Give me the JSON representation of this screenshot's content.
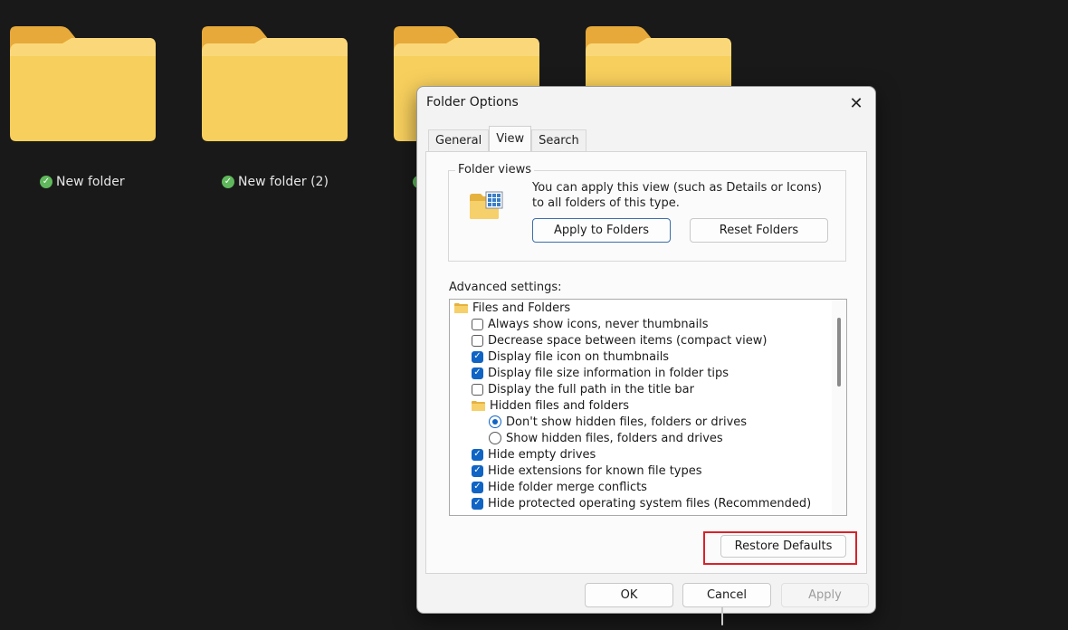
{
  "desktop": {
    "folders": [
      {
        "name": "New folder"
      },
      {
        "name": "New folder (2)"
      },
      {
        "name": ""
      },
      {
        "name": ""
      }
    ]
  },
  "dialog": {
    "title": "Folder Options",
    "close_icon": "close-icon",
    "tabs": [
      {
        "label": "General",
        "active": false
      },
      {
        "label": "View",
        "active": true
      },
      {
        "label": "Search",
        "active": false
      }
    ],
    "folder_views": {
      "legend": "Folder views",
      "description": "You can apply this view (such as Details or Icons) to all folders of this type.",
      "apply_label": "Apply to Folders",
      "reset_label": "Reset Folders"
    },
    "advanced": {
      "label": "Advanced settings:",
      "items": [
        {
          "type": "folder",
          "level": 0,
          "label": "Files and Folders"
        },
        {
          "type": "checkbox",
          "level": 1,
          "checked": false,
          "label": "Always show icons, never thumbnails"
        },
        {
          "type": "checkbox",
          "level": 1,
          "checked": false,
          "label": "Decrease space between items (compact view)"
        },
        {
          "type": "checkbox",
          "level": 1,
          "checked": true,
          "label": "Display file icon on thumbnails"
        },
        {
          "type": "checkbox",
          "level": 1,
          "checked": true,
          "label": "Display file size information in folder tips"
        },
        {
          "type": "checkbox",
          "level": 1,
          "checked": false,
          "label": "Display the full path in the title bar"
        },
        {
          "type": "folder",
          "level": 1,
          "label": "Hidden files and folders"
        },
        {
          "type": "radio",
          "level": 2,
          "checked": true,
          "label": "Don't show hidden files, folders or drives"
        },
        {
          "type": "radio",
          "level": 2,
          "checked": false,
          "label": "Show hidden files, folders and drives"
        },
        {
          "type": "checkbox",
          "level": 1,
          "checked": true,
          "label": "Hide empty drives"
        },
        {
          "type": "checkbox",
          "level": 1,
          "checked": true,
          "label": "Hide extensions for known file types"
        },
        {
          "type": "checkbox",
          "level": 1,
          "checked": true,
          "label": "Hide folder merge conflicts"
        },
        {
          "type": "checkbox",
          "level": 1,
          "checked": true,
          "label": "Hide protected operating system files (Recommended)"
        }
      ]
    },
    "restore_label": "Restore Defaults",
    "ok_label": "OK",
    "cancel_label": "Cancel",
    "apply_label": "Apply",
    "colors": {
      "accent": "#1064c4",
      "highlight": "#d8222a",
      "folder": "#f5c84b"
    }
  }
}
